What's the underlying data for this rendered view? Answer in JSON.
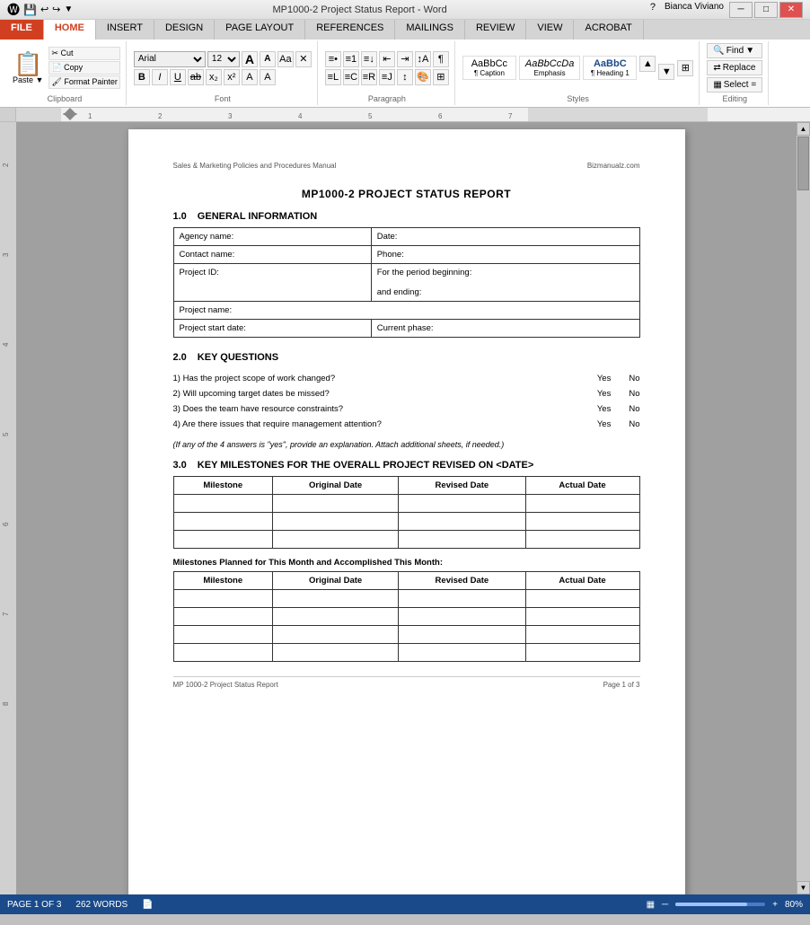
{
  "window": {
    "title": "MP1000-2 Project Status Report - Word",
    "app": "Word",
    "minimize": "─",
    "maximize": "□",
    "close": "✕"
  },
  "titlebar": {
    "icons_left": [
      "💾",
      "↩",
      "↪",
      "⚡"
    ],
    "user": "Bianca Viviano",
    "help": "?",
    "minimize": "─",
    "restore": "□",
    "close": "✕"
  },
  "tabs": {
    "active": "HOME",
    "items": [
      "FILE",
      "HOME",
      "INSERT",
      "DESIGN",
      "PAGE LAYOUT",
      "REFERENCES",
      "MAILINGS",
      "REVIEW",
      "VIEW",
      "ACROBAT"
    ]
  },
  "ribbon": {
    "clipboard_label": "Clipboard",
    "font_label": "Font",
    "paragraph_label": "Paragraph",
    "styles_label": "Styles",
    "editing_label": "Editing",
    "font_name": "Arial",
    "font_size": "12",
    "bold": "B",
    "italic": "I",
    "underline": "U",
    "styles": [
      {
        "id": "caption",
        "display": "AaBbCc",
        "label": "¶ Caption"
      },
      {
        "id": "emphasis",
        "display": "AaBbCcDa",
        "label": "Emphasis"
      },
      {
        "id": "heading1",
        "display": "AaBbC",
        "label": "¶ Heading 1"
      }
    ],
    "find": "Find",
    "replace": "Replace",
    "select": "Select ="
  },
  "document": {
    "header_left": "Sales & Marketing Policies and Procedures Manual",
    "header_right": "Bizmanualz.com",
    "title": "MP1000-2 PROJECT STATUS REPORT",
    "section1": {
      "number": "1.0",
      "heading": "GENERAL INFORMATION",
      "table": {
        "rows": [
          [
            {
              "text": "Agency name:",
              "wide": false
            },
            {
              "text": "Date:",
              "wide": false
            }
          ],
          [
            {
              "text": "Contact name:",
              "wide": false
            },
            {
              "text": "Phone:",
              "wide": false
            }
          ],
          [
            {
              "text": "Project ID:",
              "wide": false,
              "tall": true
            },
            {
              "text": "For the period beginning:\n\nand ending:",
              "wide": false,
              "tall": true
            }
          ],
          [
            {
              "text": "Project name:",
              "wide": true,
              "colspan": 2
            }
          ],
          [
            {
              "text": "Project start date:",
              "wide": false
            },
            {
              "text": "Current phase:",
              "wide": false
            }
          ]
        ]
      }
    },
    "section2": {
      "number": "2.0",
      "heading": "KEY QUESTIONS",
      "questions": [
        {
          "num": "1)",
          "text": "Has the project scope of work changed?",
          "yes": "Yes",
          "no": "No"
        },
        {
          "num": "2)",
          "text": "Will upcoming target dates be missed?",
          "yes": "Yes",
          "no": "No"
        },
        {
          "num": "3)",
          "text": "Does the team have resource constraints?",
          "yes": "Yes",
          "no": "No"
        },
        {
          "num": "4)",
          "text": "Are there issues that require management attention?",
          "yes": "Yes",
          "no": "No"
        }
      ],
      "note": "(If any of the 4 answers is \"yes\", provide an explanation. Attach additional sheets, if needed.)"
    },
    "section3": {
      "number": "3.0",
      "heading": "KEY MILESTONES FOR THE OVERALL PROJECT REVISED ON <DATE>",
      "table_headers": [
        "Milestone",
        "Original Date",
        "Revised Date",
        "Actual Date"
      ],
      "table_rows": 3,
      "milestones_label": "Milestones Planned for This Month and Accomplished This Month:",
      "milestones_rows": 4
    },
    "footer_left": "MP 1000-2 Project Status Report",
    "footer_right": "Page 1 of 3"
  },
  "statusbar": {
    "pages": "PAGE 1 OF 3",
    "words": "262 WORDS",
    "zoom": "80%",
    "zoom_level": 80
  },
  "ruler": {
    "marks": [
      "1",
      "2",
      "3",
      "4",
      "5",
      "6",
      "7"
    ]
  }
}
